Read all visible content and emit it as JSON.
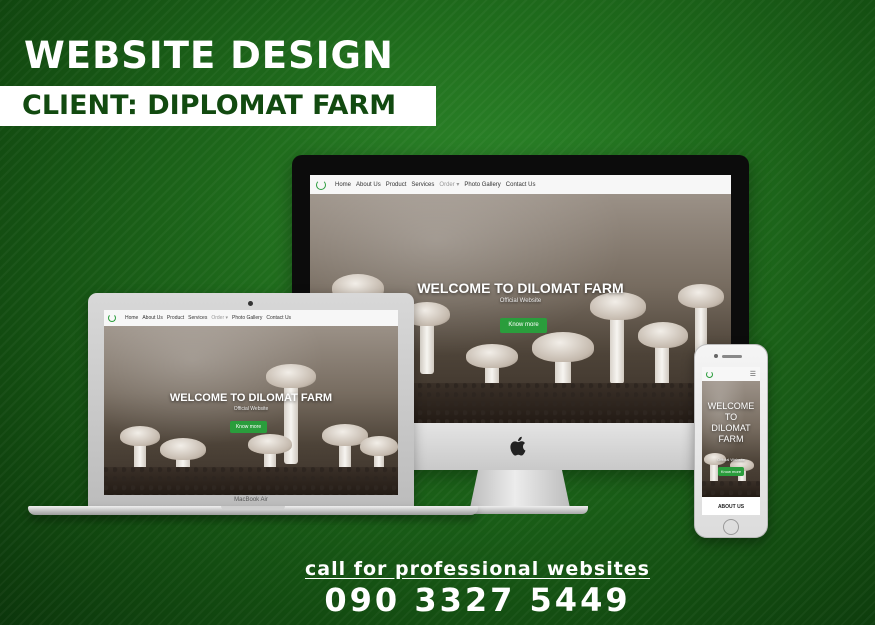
{
  "header": {
    "title": "WEBSITE DESIGN",
    "client": "CLIENT: DIPLOMAT FARM"
  },
  "website": {
    "nav_items": [
      "Home",
      "About Us",
      "Product",
      "Services",
      "Order ▾",
      "Photo Gallery",
      "Contact Us"
    ],
    "hero_title": "WELCOME TO DILOMAT FARM",
    "hero_subtitle": "Official Website",
    "hero_button": "Know more",
    "phone_hero_title": "WELCOME TO DILOMAT FARM",
    "phone_section": "ABOUT US"
  },
  "devices": {
    "laptop_label": "MacBook Air"
  },
  "footer": {
    "cta": "call for professional websites",
    "phone": "090 3327 5449"
  },
  "colors": {
    "brand_green": "#2a9d3c",
    "background_green": "#1f6b1c"
  }
}
